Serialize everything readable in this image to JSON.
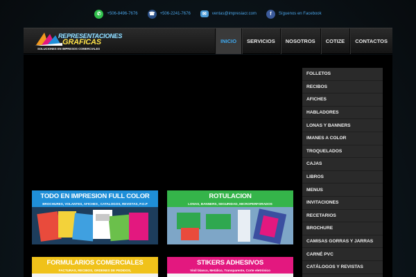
{
  "topbar": {
    "whatsapp": "+506-8496-7676",
    "phone": "+506-2241-7676",
    "email": "ventas@impresiacr.com",
    "facebook": "Síguenos en Facebook"
  },
  "logo": {
    "line1": "REPRESENTACIONES",
    "line2": "GRAFICAS",
    "tagline": "SOLUCIONES EN IMPRESOS COMERCIALES"
  },
  "nav": {
    "items": [
      {
        "label": "INICIO",
        "active": true
      },
      {
        "label": "SERVICIOS",
        "active": false
      },
      {
        "label": "NOSOTROS",
        "active": false
      },
      {
        "label": "COTIZE",
        "active": false
      },
      {
        "label": "CONTACTOS",
        "active": false
      }
    ]
  },
  "cards": [
    {
      "title": "TODO EN IMPRESION FULL COLOR",
      "subtitle": "BROCHURES, VOLANTES, AFICHES , CATALOGOS, REVISTAS, P.O.P",
      "head_color": "#1f8fd8",
      "sub_color": "#1f8fd8"
    },
    {
      "title": "ROTULACION",
      "subtitle": "LONAS, BANNERS, SEGURIDAD, MICROPERFORADOS",
      "head_color": "#35b44a",
      "sub_color": "#35b44a"
    },
    {
      "title": "FORMULARIOS COMERCIALES",
      "subtitle": "FACTURAS, RECIBOS, ORDENES DE PEDIDOS,",
      "head_color": "#f0c21a",
      "sub_color": "#f0c21a"
    },
    {
      "title": "STIKERS ADHESIVOS",
      "subtitle": "Vinil blanco, Metálico, Transparente, Corte eletrónico",
      "head_color": "#e3187f",
      "sub_color": "#e3187f"
    }
  ],
  "sidebar": {
    "items": [
      "FOLLETOS",
      "RECIBOS",
      "AFICHES",
      "HABLADORES",
      "LONAS Y BANNERS",
      "IMANES A COLOR",
      "TROQUELADOS",
      "CAJAS",
      "LIBROS",
      "MENUS",
      "INVITACIONES",
      "RECETARIOS",
      "BROCHURE",
      "CAMISAS GORRAS Y JARRAS",
      "CARNÉ PVC",
      "CATÁLOGOS Y REVISTAS"
    ]
  },
  "icons": {
    "whatsapp": "whatsapp-icon",
    "phone": "phone-icon",
    "email": "email-icon",
    "facebook": "facebook-icon"
  }
}
